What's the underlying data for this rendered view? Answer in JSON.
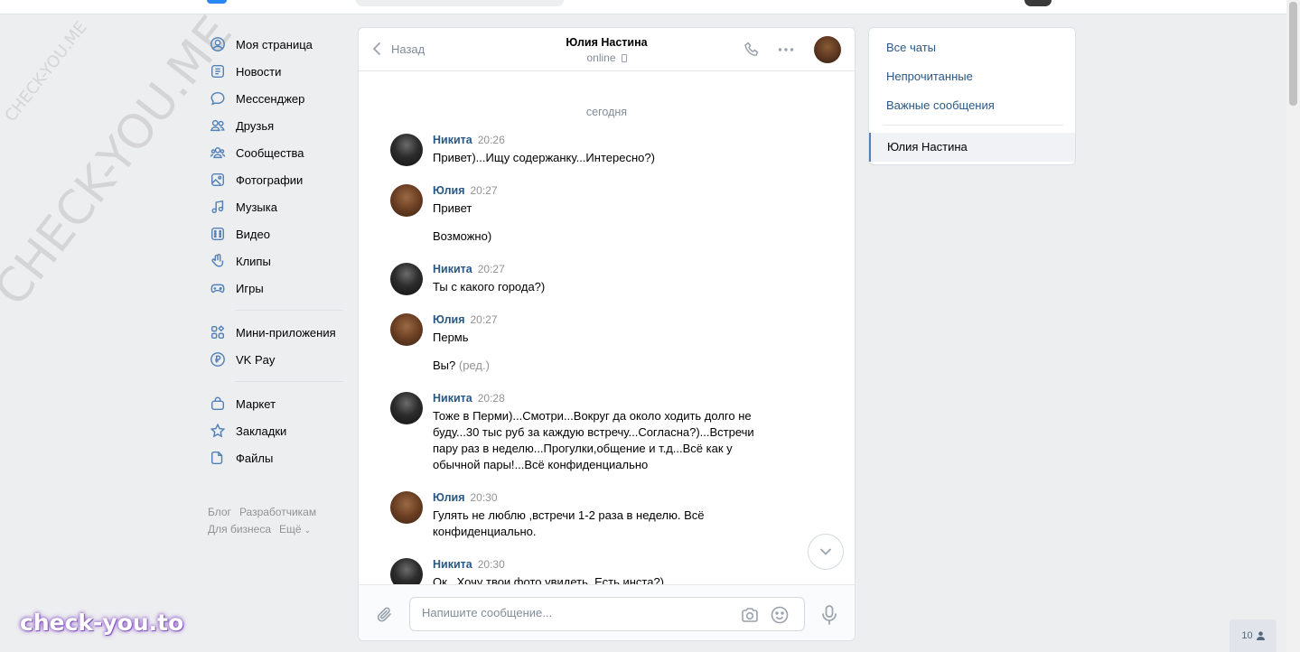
{
  "watermarks": {
    "small": "CHECK-YOU.ME",
    "big": "CHECK-YOU.ME",
    "bottom": "check-you.to"
  },
  "sidebar": {
    "items": [
      {
        "label": "Моя страница",
        "icon": "user-circle-icon"
      },
      {
        "label": "Новости",
        "icon": "news-icon"
      },
      {
        "label": "Мессенджер",
        "icon": "message-icon"
      },
      {
        "label": "Друзья",
        "icon": "friends-icon"
      },
      {
        "label": "Сообщества",
        "icon": "communities-icon"
      },
      {
        "label": "Фотографии",
        "icon": "photos-icon"
      },
      {
        "label": "Музыка",
        "icon": "music-icon"
      },
      {
        "label": "Видео",
        "icon": "video-icon"
      },
      {
        "label": "Клипы",
        "icon": "clips-icon"
      },
      {
        "label": "Игры",
        "icon": "games-icon"
      }
    ],
    "items2": [
      {
        "label": "Мини-приложения",
        "icon": "mini-apps-icon"
      },
      {
        "label": "VK Pay",
        "icon": "vkpay-icon"
      }
    ],
    "items3": [
      {
        "label": "Маркет",
        "icon": "market-icon"
      },
      {
        "label": "Закладки",
        "icon": "bookmarks-icon"
      },
      {
        "label": "Файлы",
        "icon": "files-icon"
      }
    ],
    "footer": [
      "Блог",
      "Разработчикам",
      "Для бизнеса",
      "Ещё"
    ]
  },
  "chat": {
    "back_label": "Назад",
    "peer_name": "Юлия Настина",
    "peer_status": "online",
    "date_separator": "сегодня",
    "messages": [
      {
        "author": "Никита",
        "time": "20:26",
        "lines": [
          "Привет)...Ищу содержанку...Интересно?)"
        ]
      },
      {
        "author": "Юлия",
        "time": "20:27",
        "lines": [
          "Привет",
          "Возможно)"
        ]
      },
      {
        "author": "Никита",
        "time": "20:27",
        "lines": [
          "Ты с какого города?)"
        ]
      },
      {
        "author": "Юлия",
        "time": "20:27",
        "lines": [
          "Пермь",
          "Вы?"
        ],
        "edited": "(ред.)"
      },
      {
        "author": "Никита",
        "time": "20:28",
        "lines": [
          "Тоже в Перми)...Смотри...Вокруг да около ходить долго не буду...30 тыс руб за каждую встречу...Согласна?)...Встречи пару раз в неделю...Прогулки,общение и т.д...Всё как у обычной пары!...Всё конфиденциально"
        ]
      },
      {
        "author": "Юлия",
        "time": "20:30",
        "lines": [
          "Гулять не люблю ,встречи 1-2 раза в неделю. Всё конфиденциально."
        ]
      },
      {
        "author": "Никита",
        "time": "20:30",
        "lines": [
          "Ок...Хочу твои фото увидеть. Есть инста?)"
        ]
      }
    ],
    "composer_placeholder": "Напишите сообщение..."
  },
  "filters": {
    "all": "Все чаты",
    "unread": "Непрочитанные",
    "important": "Важные сообщения",
    "active_chat": "Юлия Настина"
  },
  "online_count": "10",
  "colors": {
    "link": "#2a5885",
    "accent": "#5181b8",
    "background": "#edeef0"
  }
}
